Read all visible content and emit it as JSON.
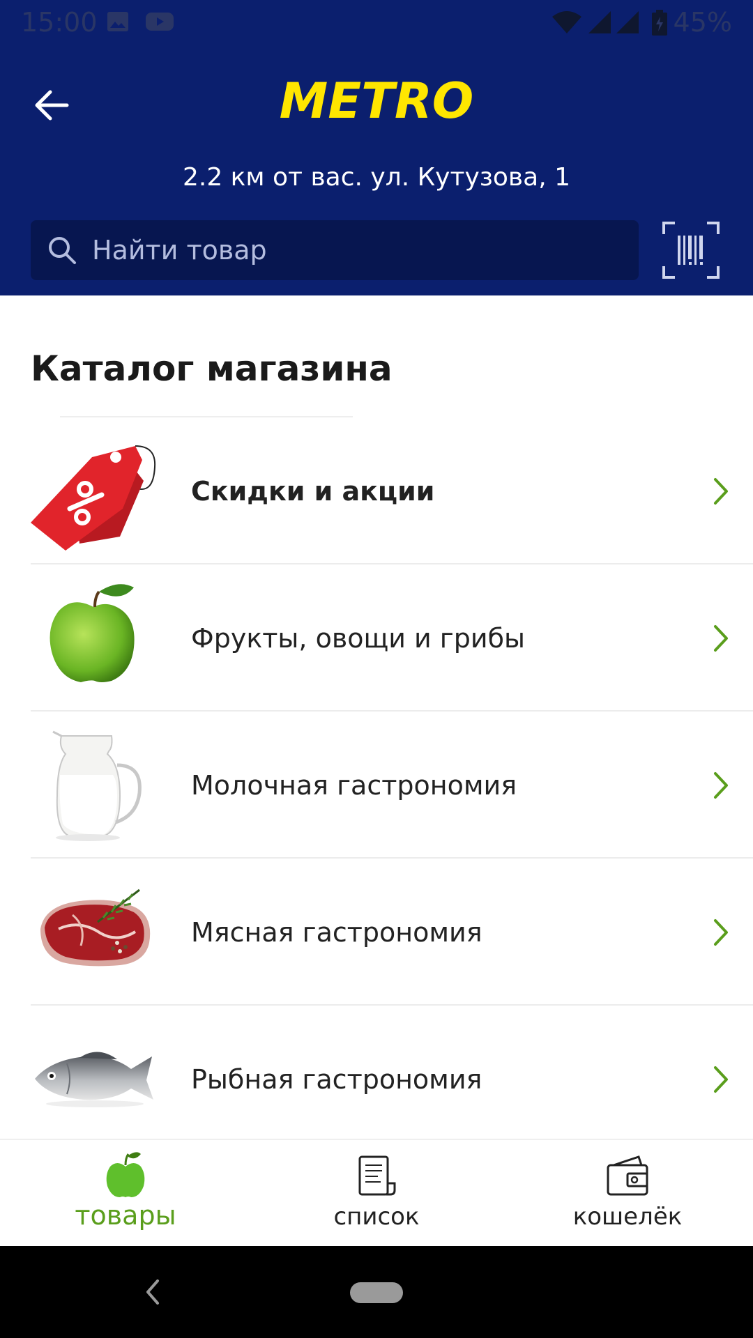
{
  "status_bar": {
    "time": "15:00",
    "battery_percent": "45%",
    "icons": [
      "image-icon",
      "youtube-icon",
      "wifi-icon",
      "signal-icon",
      "signal-icon",
      "battery-icon"
    ]
  },
  "header": {
    "logo_text": "METRO",
    "store_line": "2.2 км от вас.  ул. Кутузова, 1",
    "search_placeholder": "Найти товар",
    "back_icon": "arrow-left-icon",
    "scan_icon": "barcode-scan-icon"
  },
  "catalog": {
    "title": "Каталог магазина",
    "items": [
      {
        "label": "Скидки и акции",
        "icon": "discount-tag-icon",
        "bold": true
      },
      {
        "label": "Фрукты, овощи и грибы",
        "icon": "apple-icon",
        "bold": false
      },
      {
        "label": "Молочная гастрономия",
        "icon": "milk-jug-icon",
        "bold": false
      },
      {
        "label": "Мясная гастрономия",
        "icon": "steak-icon",
        "bold": false
      },
      {
        "label": "Рыбная гастрономия",
        "icon": "fish-icon",
        "bold": false
      }
    ]
  },
  "bottom_nav": {
    "items": [
      {
        "label": "товары",
        "icon": "apple-icon",
        "active": true
      },
      {
        "label": "список",
        "icon": "list-icon",
        "active": false
      },
      {
        "label": "кошелёк",
        "icon": "wallet-icon",
        "active": false
      }
    ]
  },
  "colors": {
    "header_bg": "#0b1f6e",
    "logo": "#ffe600",
    "active_green": "#5a9e1c",
    "chevron": "#5a9e1c"
  }
}
